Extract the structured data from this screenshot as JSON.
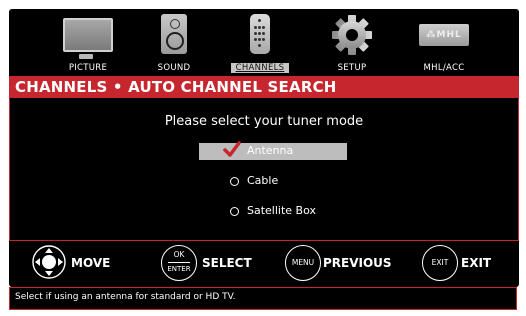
{
  "nav": {
    "items": [
      {
        "label": "PICTURE",
        "icon": "tv-icon"
      },
      {
        "label": "SOUND",
        "icon": "speaker-icon"
      },
      {
        "label": "CHANNELS",
        "icon": "remote-icon",
        "active": true
      },
      {
        "label": "SETUP",
        "icon": "gear-icon"
      },
      {
        "label": "MHL/ACC",
        "icon": "mhl-icon",
        "logo_text": "⁂MHL"
      }
    ]
  },
  "header": {
    "title": "CHANNELS • AUTO CHANNEL SEARCH"
  },
  "main": {
    "prompt": "Please select your tuner mode",
    "options": [
      {
        "label": "Antenna",
        "selected": true
      },
      {
        "label": "Cable",
        "selected": false
      },
      {
        "label": "Satellite Box",
        "selected": false
      }
    ]
  },
  "controls": {
    "move": {
      "label": "MOVE",
      "icon": "dpad-icon"
    },
    "select": {
      "label": "SELECT",
      "button_top": "OK",
      "button_bottom": "ENTER"
    },
    "previous": {
      "label": "PREVIOUS",
      "button": "MENU"
    },
    "exit": {
      "label": "EXIT",
      "button": "EXIT"
    }
  },
  "help": {
    "text": "Select if using an antenna for standard or HD TV."
  },
  "colors": {
    "accent": "#c6262d",
    "background": "#000000",
    "selection": "#bdbdbd",
    "check": "#c6262d"
  }
}
